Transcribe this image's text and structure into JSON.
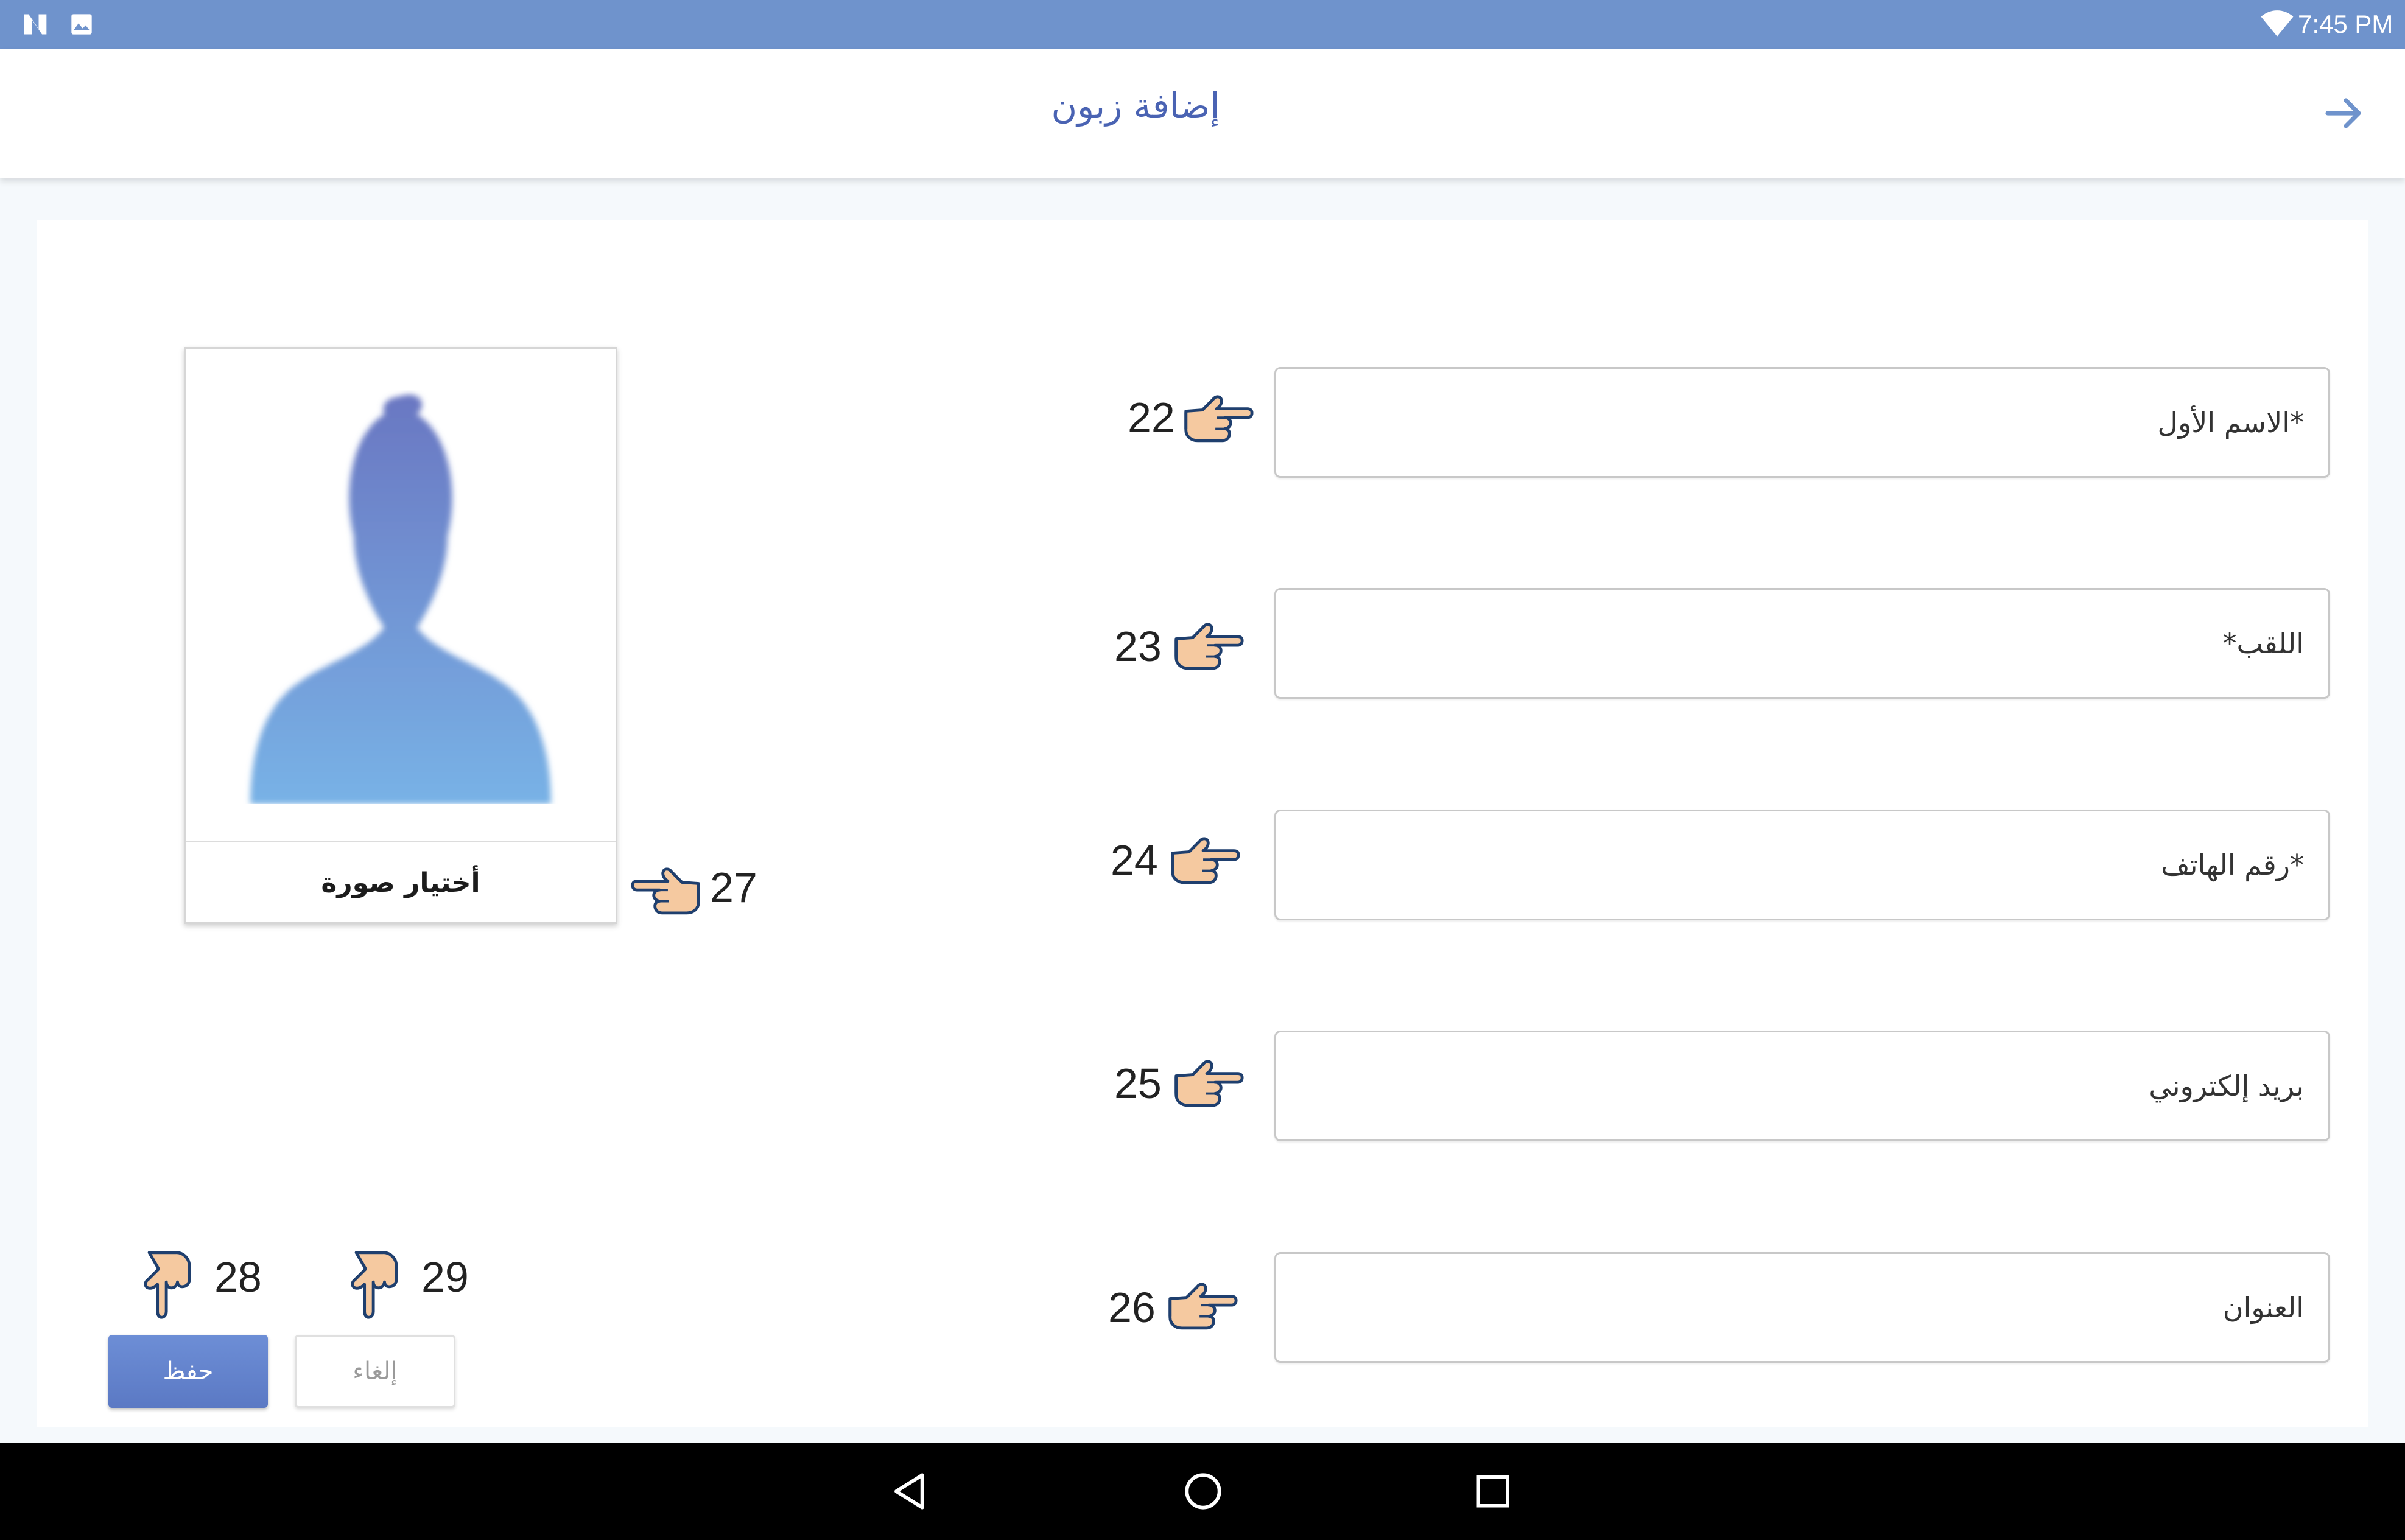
{
  "status_bar": {
    "time": "7:45 PM",
    "icons": [
      "notification-n-icon",
      "image-icon",
      "wifi-icon"
    ]
  },
  "header": {
    "title": "إضافة زبون",
    "back_icon": "arrow-right-icon"
  },
  "form": {
    "fields": [
      {
        "label": "*الاسم الأول",
        "annotation": "22"
      },
      {
        "label": "اللقب*",
        "annotation": "23"
      },
      {
        "label": "*رقم الهاتف",
        "annotation": "24"
      },
      {
        "label": "بريد إلكتروني",
        "annotation": "25"
      },
      {
        "label": "العنوان",
        "annotation": "26"
      }
    ]
  },
  "photo": {
    "choose_label": "أختيار صورة",
    "annotation": "27"
  },
  "buttons": {
    "save_label": "حفظ",
    "save_annotation": "28",
    "cancel_label": "إلغاء",
    "cancel_annotation": "29"
  },
  "nav_bar": {
    "icons": [
      "back-triangle-icon",
      "home-circle-icon",
      "recents-square-icon"
    ]
  },
  "colors": {
    "status_bar": "#6f93cc",
    "accent": "#4a63b3",
    "save_button": "#6282cd"
  }
}
